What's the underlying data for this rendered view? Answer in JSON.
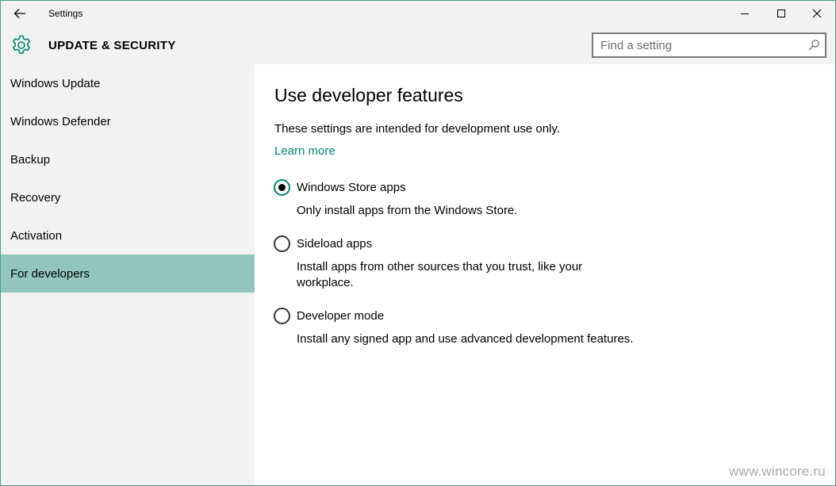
{
  "window": {
    "title": "Settings",
    "controls": [
      "minimize",
      "maximize",
      "close"
    ]
  },
  "header": {
    "section_title": "UPDATE & SECURITY",
    "search_placeholder": "Find a setting"
  },
  "sidebar": {
    "items": [
      {
        "label": "Windows Update",
        "selected": false
      },
      {
        "label": "Windows Defender",
        "selected": false
      },
      {
        "label": "Backup",
        "selected": false
      },
      {
        "label": "Recovery",
        "selected": false
      },
      {
        "label": "Activation",
        "selected": false
      },
      {
        "label": "For developers",
        "selected": true
      }
    ]
  },
  "main": {
    "title": "Use developer features",
    "intro": "These settings are intended for development use only.",
    "learn_more": "Learn more",
    "options": [
      {
        "label": "Windows Store apps",
        "description": "Only install apps from the Windows Store.",
        "checked": true
      },
      {
        "label": "Sideload apps",
        "description": "Install apps from other sources that you trust, like your workplace.",
        "checked": false
      },
      {
        "label": "Developer mode",
        "description": "Install any signed app and use advanced development features.",
        "checked": false
      }
    ]
  },
  "watermark": "www.wincore.ru",
  "colors": {
    "accent": "#00856f",
    "selected_nav": "#92c6bc",
    "border": "#4b9c8c"
  },
  "icons": {
    "back": "arrow-left-icon",
    "settings": "gear-icon",
    "search": "search-icon",
    "minimize": "minimize-icon",
    "maximize": "maximize-icon",
    "close": "close-icon"
  }
}
